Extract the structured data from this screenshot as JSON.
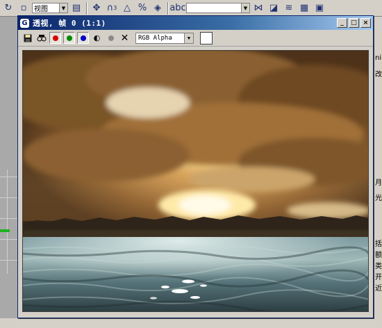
{
  "app_toolbar": {
    "view_select_value": "视图",
    "snap_label_3": "3",
    "angle_snap_label": "%",
    "named_selection_value": "",
    "icons": [
      "undo-icon",
      "select-object-icon",
      "view-select",
      "select-filter-icon",
      "move-icon",
      "snap-3d-icon",
      "angle-snap-icon",
      "percent-snap-icon",
      "spinner-snap-icon",
      "edit-named-selection-icon",
      "named-selection-select",
      "mirror-icon",
      "align-icon",
      "layers-icon",
      "curve-editor-icon",
      "schematic-view-icon"
    ]
  },
  "render_window": {
    "title": "透视, 帧 0 (1:1)",
    "minimize_label": "_",
    "maximize_label": "□",
    "close_label": "×",
    "toolbar": {
      "save_icon": "save-icon",
      "clone_icon": "clone-icon",
      "red_channel_color": "#d40000",
      "green_channel_color": "#008a00",
      "blue_channel_color": "#0000c8",
      "mono_icon": "monochrome-icon",
      "clear_label": "✕",
      "channel_select_value": "RGB Alpha",
      "swatch_color": "#ffffff"
    },
    "image": {
      "subject": "sunset",
      "colors": {
        "sky_top": "#7a5228",
        "sun": "#fff4d0",
        "horizon_band": "#3b2e22",
        "water": "#5b7e8a"
      }
    }
  },
  "right_panel": {
    "labels": [
      "ni",
      "改",
      "月",
      "光",
      "括",
      "额",
      "类",
      "开",
      "近"
    ]
  }
}
